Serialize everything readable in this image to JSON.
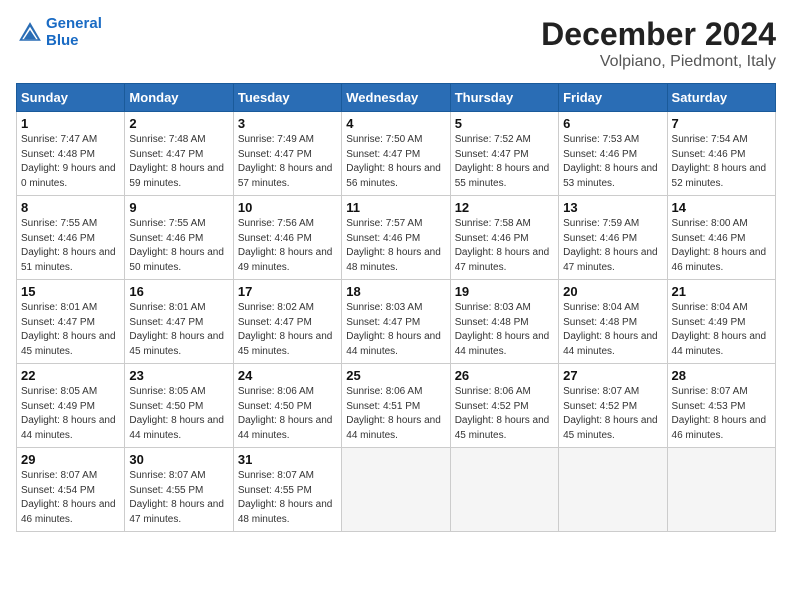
{
  "header": {
    "logo_line1": "General",
    "logo_line2": "Blue",
    "month_title": "December 2024",
    "location": "Volpiano, Piedmont, Italy"
  },
  "weekdays": [
    "Sunday",
    "Monday",
    "Tuesday",
    "Wednesday",
    "Thursday",
    "Friday",
    "Saturday"
  ],
  "weeks": [
    [
      {
        "day": 1,
        "sunrise": "7:47 AM",
        "sunset": "4:48 PM",
        "daylight": "9 hours and 0 minutes."
      },
      {
        "day": 2,
        "sunrise": "7:48 AM",
        "sunset": "4:47 PM",
        "daylight": "8 hours and 59 minutes."
      },
      {
        "day": 3,
        "sunrise": "7:49 AM",
        "sunset": "4:47 PM",
        "daylight": "8 hours and 57 minutes."
      },
      {
        "day": 4,
        "sunrise": "7:50 AM",
        "sunset": "4:47 PM",
        "daylight": "8 hours and 56 minutes."
      },
      {
        "day": 5,
        "sunrise": "7:52 AM",
        "sunset": "4:47 PM",
        "daylight": "8 hours and 55 minutes."
      },
      {
        "day": 6,
        "sunrise": "7:53 AM",
        "sunset": "4:46 PM",
        "daylight": "8 hours and 53 minutes."
      },
      {
        "day": 7,
        "sunrise": "7:54 AM",
        "sunset": "4:46 PM",
        "daylight": "8 hours and 52 minutes."
      }
    ],
    [
      {
        "day": 8,
        "sunrise": "7:55 AM",
        "sunset": "4:46 PM",
        "daylight": "8 hours and 51 minutes."
      },
      {
        "day": 9,
        "sunrise": "7:55 AM",
        "sunset": "4:46 PM",
        "daylight": "8 hours and 50 minutes."
      },
      {
        "day": 10,
        "sunrise": "7:56 AM",
        "sunset": "4:46 PM",
        "daylight": "8 hours and 49 minutes."
      },
      {
        "day": 11,
        "sunrise": "7:57 AM",
        "sunset": "4:46 PM",
        "daylight": "8 hours and 48 minutes."
      },
      {
        "day": 12,
        "sunrise": "7:58 AM",
        "sunset": "4:46 PM",
        "daylight": "8 hours and 47 minutes."
      },
      {
        "day": 13,
        "sunrise": "7:59 AM",
        "sunset": "4:46 PM",
        "daylight": "8 hours and 47 minutes."
      },
      {
        "day": 14,
        "sunrise": "8:00 AM",
        "sunset": "4:46 PM",
        "daylight": "8 hours and 46 minutes."
      }
    ],
    [
      {
        "day": 15,
        "sunrise": "8:01 AM",
        "sunset": "4:47 PM",
        "daylight": "8 hours and 45 minutes."
      },
      {
        "day": 16,
        "sunrise": "8:01 AM",
        "sunset": "4:47 PM",
        "daylight": "8 hours and 45 minutes."
      },
      {
        "day": 17,
        "sunrise": "8:02 AM",
        "sunset": "4:47 PM",
        "daylight": "8 hours and 45 minutes."
      },
      {
        "day": 18,
        "sunrise": "8:03 AM",
        "sunset": "4:47 PM",
        "daylight": "8 hours and 44 minutes."
      },
      {
        "day": 19,
        "sunrise": "8:03 AM",
        "sunset": "4:48 PM",
        "daylight": "8 hours and 44 minutes."
      },
      {
        "day": 20,
        "sunrise": "8:04 AM",
        "sunset": "4:48 PM",
        "daylight": "8 hours and 44 minutes."
      },
      {
        "day": 21,
        "sunrise": "8:04 AM",
        "sunset": "4:49 PM",
        "daylight": "8 hours and 44 minutes."
      }
    ],
    [
      {
        "day": 22,
        "sunrise": "8:05 AM",
        "sunset": "4:49 PM",
        "daylight": "8 hours and 44 minutes."
      },
      {
        "day": 23,
        "sunrise": "8:05 AM",
        "sunset": "4:50 PM",
        "daylight": "8 hours and 44 minutes."
      },
      {
        "day": 24,
        "sunrise": "8:06 AM",
        "sunset": "4:50 PM",
        "daylight": "8 hours and 44 minutes."
      },
      {
        "day": 25,
        "sunrise": "8:06 AM",
        "sunset": "4:51 PM",
        "daylight": "8 hours and 44 minutes."
      },
      {
        "day": 26,
        "sunrise": "8:06 AM",
        "sunset": "4:52 PM",
        "daylight": "8 hours and 45 minutes."
      },
      {
        "day": 27,
        "sunrise": "8:07 AM",
        "sunset": "4:52 PM",
        "daylight": "8 hours and 45 minutes."
      },
      {
        "day": 28,
        "sunrise": "8:07 AM",
        "sunset": "4:53 PM",
        "daylight": "8 hours and 46 minutes."
      }
    ],
    [
      {
        "day": 29,
        "sunrise": "8:07 AM",
        "sunset": "4:54 PM",
        "daylight": "8 hours and 46 minutes."
      },
      {
        "day": 30,
        "sunrise": "8:07 AM",
        "sunset": "4:55 PM",
        "daylight": "8 hours and 47 minutes."
      },
      {
        "day": 31,
        "sunrise": "8:07 AM",
        "sunset": "4:55 PM",
        "daylight": "8 hours and 48 minutes."
      },
      null,
      null,
      null,
      null
    ]
  ]
}
